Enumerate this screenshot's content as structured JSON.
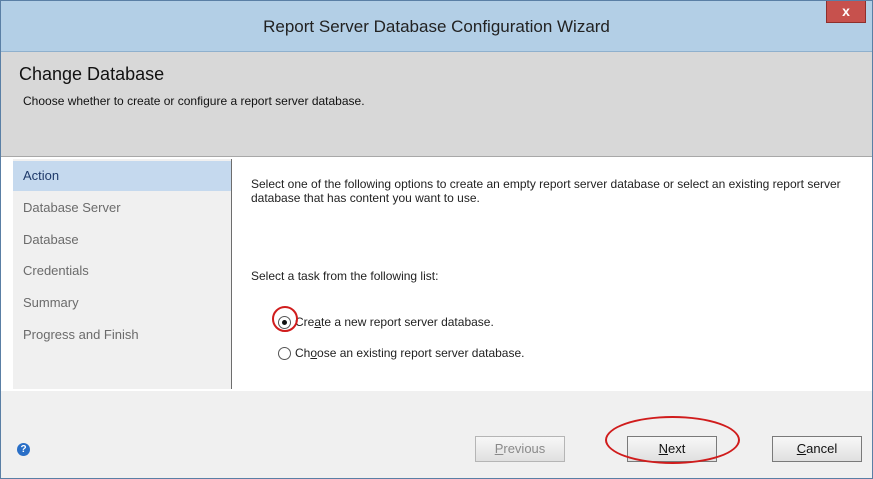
{
  "window": {
    "title": "Report Server Database Configuration Wizard",
    "close_glyph": "x"
  },
  "header": {
    "title": "Change Database",
    "subtitle": "Choose whether to create or configure a report server database."
  },
  "sidebar": {
    "items": [
      {
        "label": "Action",
        "active": true
      },
      {
        "label": "Database Server",
        "active": false
      },
      {
        "label": "Database",
        "active": false
      },
      {
        "label": "Credentials",
        "active": false
      },
      {
        "label": "Summary",
        "active": false
      },
      {
        "label": "Progress and Finish",
        "active": false
      }
    ]
  },
  "content": {
    "description": "Select one of the following options to create an empty report server database or select an existing report server database that has content you want to use.",
    "task_label": "Select a task from the following list:",
    "options": [
      {
        "pre": "Cre",
        "mnemonic": "a",
        "post": "te a new report server database.",
        "checked": true
      },
      {
        "pre": "Ch",
        "mnemonic": "o",
        "post": "ose an existing report server database.",
        "checked": false
      }
    ]
  },
  "footer": {
    "help_glyph": "?",
    "previous": {
      "mnemonic": "P",
      "rest": "revious",
      "enabled": false
    },
    "next": {
      "mnemonic": "N",
      "rest": "ext",
      "enabled": true
    },
    "cancel": {
      "mnemonic": "C",
      "rest": "ancel",
      "enabled": true
    }
  },
  "colors": {
    "titlebar": "#b3cfe6",
    "header_bg": "#d8d8d8",
    "sidebar_active": "#c5d9ee",
    "annotation": "#d01c1c"
  }
}
